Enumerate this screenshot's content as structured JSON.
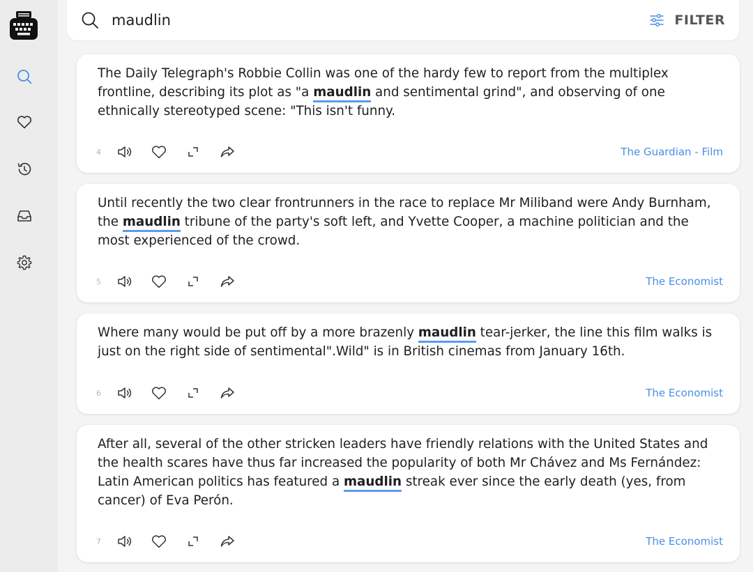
{
  "search": {
    "query": "maudlin"
  },
  "filter": {
    "label": "FILTER"
  },
  "sidebar": {
    "items": [
      {
        "name": "search",
        "icon": "search-icon",
        "active": true
      },
      {
        "name": "favorites",
        "icon": "heart-icon"
      },
      {
        "name": "history",
        "icon": "history-icon"
      },
      {
        "name": "inbox",
        "icon": "inbox-icon"
      },
      {
        "name": "settings",
        "icon": "gear-icon"
      }
    ]
  },
  "colors": {
    "accent": "#4a8ee6",
    "highlight": "#5b9af2"
  },
  "results": [
    {
      "index": "4",
      "before": "The Daily Telegraph's Robbie Collin was one of the hardy few to report from the multiplex frontline, describing its plot as \"a ",
      "word": "maudlin",
      "after": " and sentimental grind\", and observing of one ethnically stereotyped scene: \"This isn't funny.",
      "source": "The Guardian - Film"
    },
    {
      "index": "5",
      "before": "Until recently the two clear frontrunners in the race to replace Mr Miliband were Andy Burnham, the ",
      "word": "maudlin",
      "after": " tribune of the party's soft left, and Yvette Cooper, a machine politician and the most experienced of the crowd.",
      "source": "The Economist"
    },
    {
      "index": "6",
      "before": "Where many would be put off by a more brazenly ",
      "word": "maudlin",
      "after": " tear-jerker, the line this film walks is just on the right side of sentimental\".Wild\" is in British cinemas from January 16th.",
      "source": "The Economist"
    },
    {
      "index": "7",
      "before": "After all, several of the other stricken leaders have friendly relations with the United States and the health scares have thus far increased the popularity of both Mr Chávez and Ms Fernández: Latin American politics has featured a ",
      "word": "maudlin",
      "after": " streak ever since the early death (yes, from cancer) of Eva Perón.",
      "source": "The Economist"
    }
  ]
}
